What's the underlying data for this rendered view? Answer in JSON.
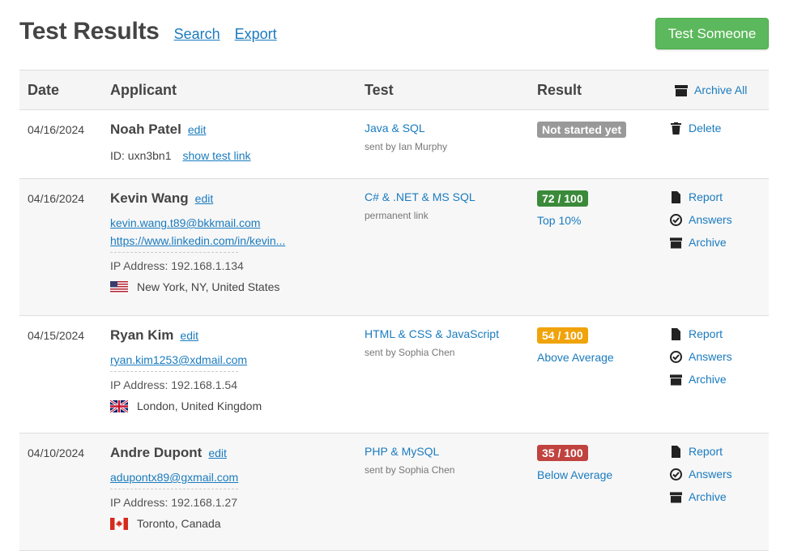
{
  "header": {
    "title": "Test Results",
    "search_label": "Search",
    "export_label": "Export",
    "test_someone_label": "Test Someone"
  },
  "colors": {
    "link": "#1a7bbf",
    "primary_button": "#5cb85c",
    "badge_not_started": "#999999",
    "badge_good": "#3a8a3a",
    "badge_average": "#f0a30a",
    "badge_poor": "#c0433f"
  },
  "table": {
    "columns": [
      "Date",
      "Applicant",
      "Test",
      "Result"
    ],
    "archive_all_label": "Archive All",
    "rows": [
      {
        "date": "04/16/2024",
        "name": "Noah Patel",
        "edit_label": "edit",
        "id_text": "ID: uxn3bn1",
        "show_link_label": "show test link",
        "test": "Java & SQL",
        "test_sub": "sent by Ian Murphy",
        "badge": "Not started yet",
        "badge_color": "#999999",
        "delete_label": "Delete"
      },
      {
        "date": "04/16/2024",
        "name": "Kevin Wang",
        "edit_label": "edit",
        "email": "kevin.wang.t89@bkkmail.com",
        "linkedin": "https://www.linkedin.com/in/kevin...",
        "ip": "IP Address: 192.168.1.134",
        "location": "New York, NY, United States",
        "flag": "us-flag-icon",
        "test": "C# & .NET & MS SQL",
        "test_sub": "permanent link",
        "badge": "72 / 100",
        "badge_color": "#3a8a3a",
        "result_text": "Top 10%",
        "report_label": "Report",
        "answers_label": "Answers",
        "archive_label": "Archive"
      },
      {
        "date": "04/15/2024",
        "name": "Ryan Kim",
        "edit_label": "edit",
        "email": "ryan.kim1253@xdmail.com",
        "ip": "IP Address: 192.168.1.54",
        "location": "London, United Kingdom",
        "flag": "uk-flag-icon",
        "test": "HTML & CSS & JavaScript",
        "test_sub": "sent by Sophia Chen",
        "badge": "54 / 100",
        "badge_color": "#f0a30a",
        "result_text": "Above Average",
        "report_label": "Report",
        "answers_label": "Answers",
        "archive_label": "Archive"
      },
      {
        "date": "04/10/2024",
        "name": "Andre Dupont",
        "edit_label": "edit",
        "email": "adupontx89@gxmail.com",
        "ip": "IP Address: 192.168.1.27",
        "location": "Toronto, Canada",
        "flag": "canada-flag-icon",
        "test": "PHP & MySQL",
        "test_sub": "sent by Sophia Chen",
        "badge": "35 / 100",
        "badge_color": "#c0433f",
        "result_text": "Below Average",
        "report_label": "Report",
        "answers_label": "Answers",
        "archive_label": "Archive"
      }
    ]
  }
}
